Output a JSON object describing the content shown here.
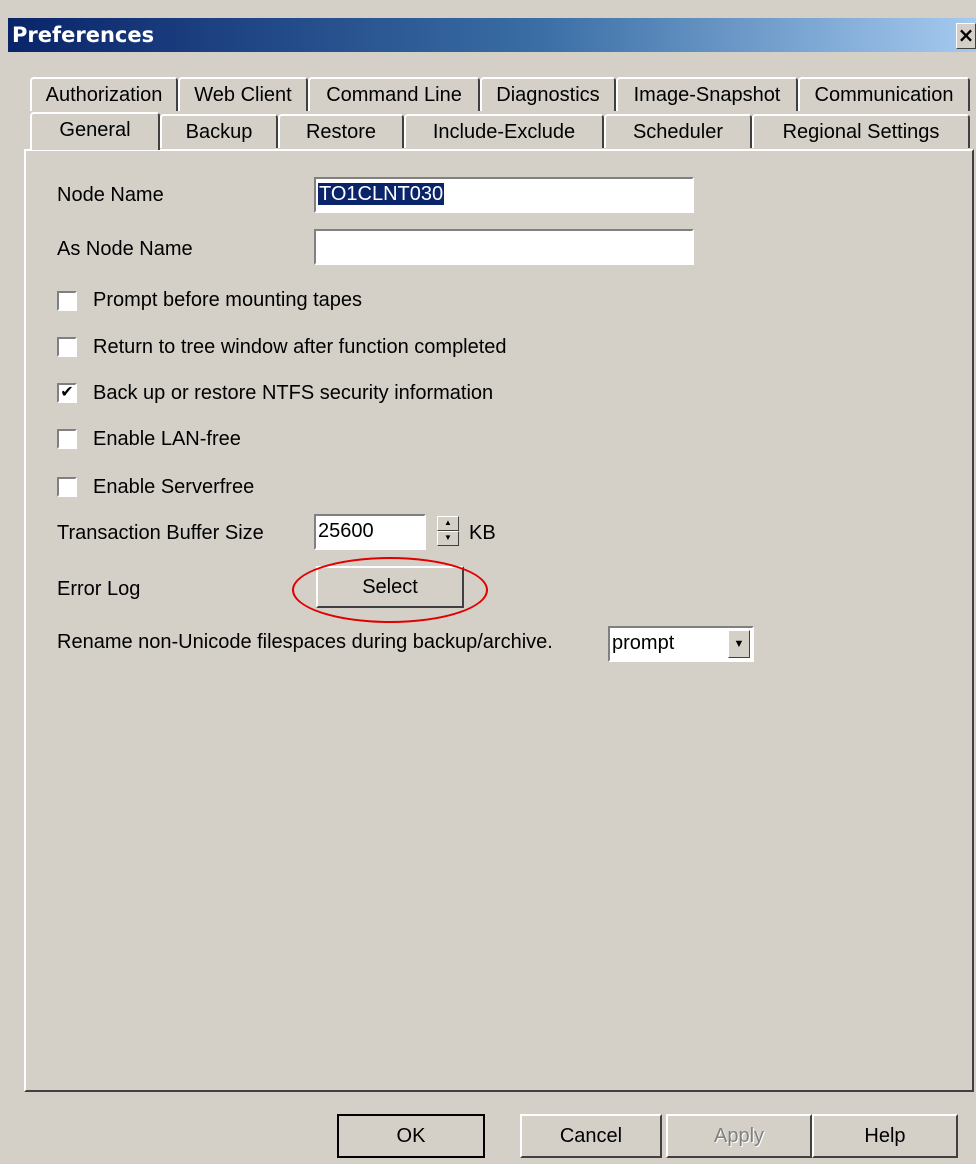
{
  "window": {
    "title": "Preferences",
    "close_glyph": "×"
  },
  "tabs_back": [
    "Authorization",
    "Web Client",
    "Command Line",
    "Diagnostics",
    "Image-Snapshot",
    "Communication"
  ],
  "tabs_front": [
    "General",
    "Backup",
    "Restore",
    "Include-Exclude",
    "Scheduler",
    "Regional Settings"
  ],
  "active_tab": "General",
  "general": {
    "node_name_label": "Node Name",
    "node_name_value": "TO1CLNT030",
    "as_node_name_label": "As Node Name",
    "as_node_name_value": "",
    "checkboxes": [
      {
        "label": "Prompt before mounting tapes",
        "checked": false
      },
      {
        "label": "Return to tree window after function completed",
        "checked": false
      },
      {
        "label": "Back up or restore NTFS security information",
        "checked": true
      },
      {
        "label": "Enable LAN-free",
        "checked": false
      },
      {
        "label": "Enable Serverfree",
        "checked": false
      }
    ],
    "check_glyph": "✔",
    "tx_buffer_label": "Transaction Buffer Size",
    "tx_buffer_value": "25600",
    "tx_buffer_unit": "KB",
    "error_log_label": "Error Log",
    "select_button": "Select",
    "rename_label": "Rename non-Unicode filespaces during backup/archive.",
    "rename_value": "prompt"
  },
  "footer": {
    "ok": "OK",
    "cancel": "Cancel",
    "apply": "Apply",
    "help": "Help"
  },
  "colors": {
    "face": "#d4d0c8",
    "title_start": "#0a246a",
    "title_end": "#a6caf0",
    "highlight_oval": "#e00000",
    "disabled_text": "#808080"
  }
}
